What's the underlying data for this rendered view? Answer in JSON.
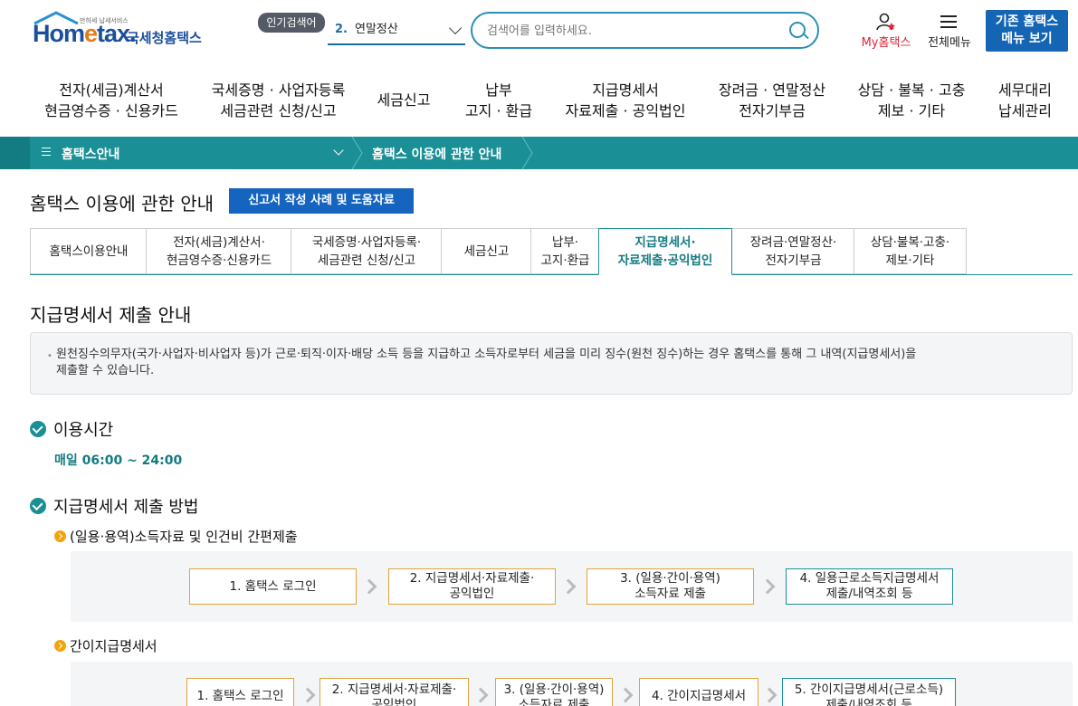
{
  "header": {
    "logo_small": "만하세 납세서비스",
    "logo_text_a": "Hom",
    "logo_text_e": "e",
    "logo_text_b": "tax.",
    "logo_kr": "국세청홈택스",
    "popular_badge": "인기검색어",
    "popular_num": "2.",
    "popular_term": "연말정산",
    "search_placeholder": "검색어를 입력하세요.",
    "my_hometax": "My홈택스",
    "all_menu": "전체메뉴",
    "old_menu_1": "기존 홈택스",
    "old_menu_2": "메뉴 보기"
  },
  "gnb": [
    {
      "l1": "전자(세금)계산서",
      "l2": "현금영수증 · 신용카드"
    },
    {
      "l1": "국세증명 · 사업자등록",
      "l2": "세금관련 신청/신고"
    },
    {
      "l1": "세금신고",
      "l2": ""
    },
    {
      "l1": "납부",
      "l2": "고지 · 환급"
    },
    {
      "l1": "지급명세서",
      "l2": "자료제출 · 공익법인"
    },
    {
      "l1": "장려금 · 연말정산",
      "l2": "전자기부금"
    },
    {
      "l1": "상담 · 불복 · 고충",
      "l2": "제보 · 기타"
    },
    {
      "l1": "세무대리",
      "l2": "납세관리"
    }
  ],
  "breadcrumb": {
    "level1": "홈택스안내",
    "level2": "홈택스 이용에 관한 안내"
  },
  "page": {
    "title": "홈택스 이용에 관한 안내",
    "guide_button": "신고서 작성 사례 및 도움자료"
  },
  "tabs": [
    {
      "l1": "홈택스이용안내",
      "l2": ""
    },
    {
      "l1": "전자(세금)계산서·",
      "l2": "현금영수증·신용카드"
    },
    {
      "l1": "국세증명·사업자등록·",
      "l2": "세금관련 신청/신고"
    },
    {
      "l1": "세금신고",
      "l2": ""
    },
    {
      "l1": "납부·",
      "l2": "고지·환급"
    },
    {
      "l1": "지급명세서·",
      "l2": "자료제출·공익법인"
    },
    {
      "l1": "장려금·연말정산·",
      "l2": "전자기부금"
    },
    {
      "l1": "상담·불복·고충·",
      "l2": "제보·기타"
    }
  ],
  "section": {
    "title": "지급명세서 제출 안내",
    "info_line1": "원천징수의무자(국가·사업자·비사업자 등)가 근로·퇴직·이자·배당 소득 등을 지급하고 소득자로부터 세금을 미리 징수(원천 징수)하는 경우 홈택스를 통해 그 내역(지급명세서)을",
    "info_line2": "제출할 수 있습니다.",
    "hours_title": "이용시간",
    "hours_value": "매일 06:00 ~ 24:00",
    "method_title": "지급명세서 제출 방법",
    "sub1_title": "(일용·용역)소득자료 및 인건비 간편제출",
    "sub1_steps": [
      {
        "l1": "1. 홈택스 로그인",
        "l2": ""
      },
      {
        "l1": "2. 지급명세서·자료제출·",
        "l2": "공익법인"
      },
      {
        "l1": "3. (일용·간이·용역)",
        "l2": "소득자료 제출"
      },
      {
        "l1": "4. 일용근로소득지급명세서",
        "l2": "제출/내역조회 등"
      }
    ],
    "sub2_title": "간이지급명세서",
    "sub2_steps": [
      {
        "l1": "1. 홈택스 로그인",
        "l2": ""
      },
      {
        "l1": "2. 지급명세서·자료제출·",
        "l2": "공익법인"
      },
      {
        "l1": "3. (일용·간이·용역)",
        "l2": "소득자료 제출"
      },
      {
        "l1": "4. 간이지급명세서",
        "l2": ""
      },
      {
        "l1": "5. 간이지급명세서(근로소득)",
        "l2": "제출/내역조회 등"
      }
    ]
  },
  "colors": {
    "teal": "#1a8f96",
    "blue": "#1565c0",
    "orange": "#e2a23e",
    "red": "#e1253a"
  }
}
